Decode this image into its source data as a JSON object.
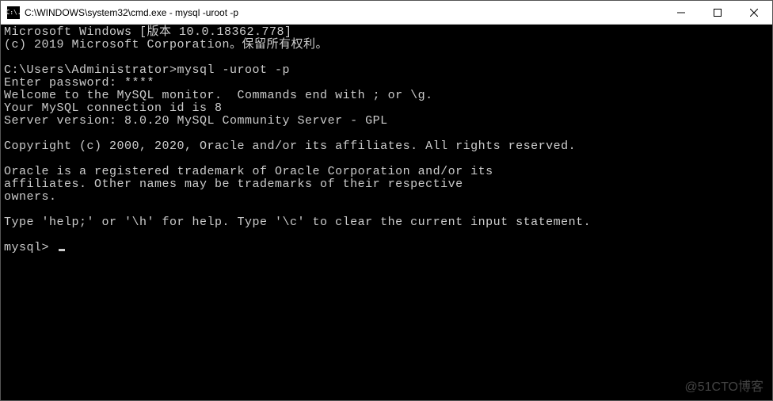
{
  "window": {
    "icon_text": "C:\\.",
    "title": "C:\\WINDOWS\\system32\\cmd.exe - mysql  -uroot -p"
  },
  "terminal": {
    "lines": [
      "Microsoft Windows [版本 10.0.18362.778]",
      "(c) 2019 Microsoft Corporation。保留所有权利。",
      "",
      "C:\\Users\\Administrator>mysql -uroot -p",
      "Enter password: ****",
      "Welcome to the MySQL monitor.  Commands end with ; or \\g.",
      "Your MySQL connection id is 8",
      "Server version: 8.0.20 MySQL Community Server - GPL",
      "",
      "Copyright (c) 2000, 2020, Oracle and/or its affiliates. All rights reserved.",
      "",
      "Oracle is a registered trademark of Oracle Corporation and/or its",
      "affiliates. Other names may be trademarks of their respective",
      "owners.",
      "",
      "Type 'help;' or '\\h' for help. Type '\\c' to clear the current input statement.",
      "",
      "mysql> "
    ]
  },
  "watermark": "@51CTO博客"
}
